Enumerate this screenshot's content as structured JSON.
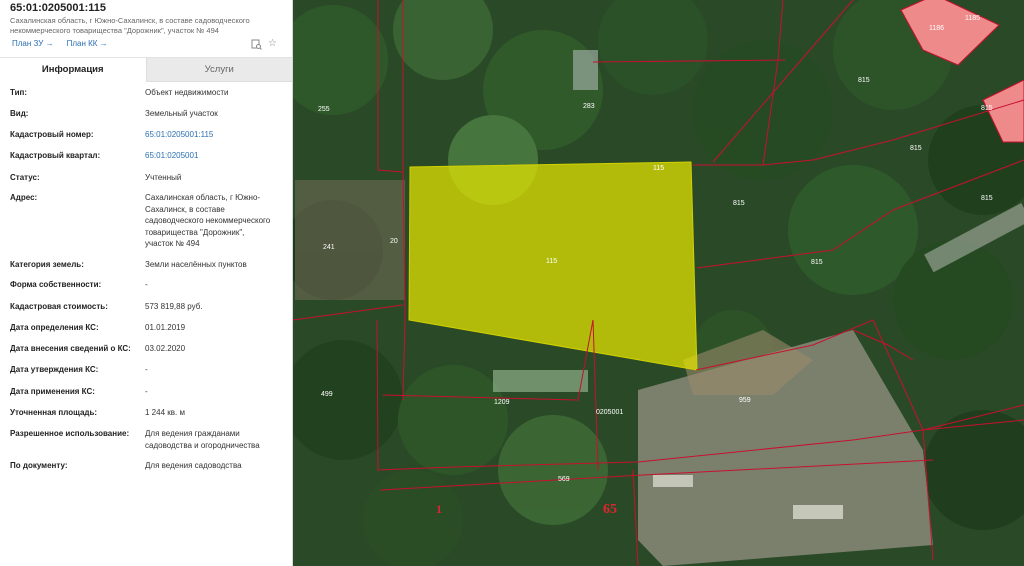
{
  "header": {
    "cadastral_number": "65:01:0205001:115",
    "address_line1": "Сахалинская область, г Южно-Сахалинск, в составе садоводческого",
    "address_line2": "некоммерческого товарищества \"Дорожник\", участок № 494"
  },
  "links": {
    "plan_zu": "План ЗУ",
    "plan_kk": "План КК"
  },
  "icons": {
    "docs": "doc-search-icon",
    "favorite": "star-icon"
  },
  "tabs": [
    {
      "label": "Информация",
      "active": true
    },
    {
      "label": "Услуги",
      "active": false
    }
  ],
  "info": {
    "type": {
      "label": "Тип:",
      "value": "Объект недвижимости"
    },
    "kind": {
      "label": "Вид:",
      "value": "Земельный участок"
    },
    "cad_number": {
      "label": "Кадастровый номер:",
      "value": "65:01:0205001:115"
    },
    "cad_quarter": {
      "label": "Кадастровый квартал:",
      "value": "65:01:0205001"
    },
    "status": {
      "label": "Статус:",
      "value": "Учтенный"
    },
    "address": {
      "label": "Адрес:",
      "lines": [
        "Сахалинская область, г Южно-",
        "Сахалинск, в составе",
        "садоводческого некоммерческого",
        "товарищества \"Дорожник\",",
        "участок № 494"
      ]
    },
    "land_category": {
      "label": "Категория земель:",
      "value": "Земли населённых пунктов"
    },
    "ownership": {
      "label": "Форма собственности:",
      "value": "-"
    },
    "cad_value": {
      "label": "Кадастровая стоимость:",
      "value": "573 819,88 руб."
    },
    "date_ks": {
      "label": "Дата определения КС:",
      "value": "01.01.2019"
    },
    "date_entry_ks": {
      "label": "Дата внесения сведений о КС:",
      "value": "03.02.2020"
    },
    "date_approval_ks": {
      "label": "Дата утверждения КС:",
      "value": "-"
    },
    "date_apply_ks": {
      "label": "Дата применения КС:",
      "value": "-"
    },
    "area": {
      "label": "Уточненная площадь:",
      "value": "1 244 кв. м"
    },
    "permitted_use": {
      "label": "Разрешенное использование:",
      "lines": [
        "Для ведения гражданами",
        "садоводства и огородничества"
      ]
    },
    "by_document": {
      "label": "По документу:",
      "value": "Для ведения садоводства"
    }
  },
  "map": {
    "colors": {
      "selected_fill": "#e8e800",
      "boundary": "#c8102e",
      "highlight_parcel": "#ee8a8a",
      "label_red": "#e0242f"
    },
    "parcel_labels": [
      "115",
      "115",
      "1186",
      "1185",
      "815",
      "815",
      "815",
      "815",
      "815",
      "815",
      "255",
      "283",
      "241",
      "20",
      "499",
      "1209",
      "959",
      "569"
    ],
    "quarter_label": "0205001",
    "district_label": "65",
    "block_label": "1"
  }
}
